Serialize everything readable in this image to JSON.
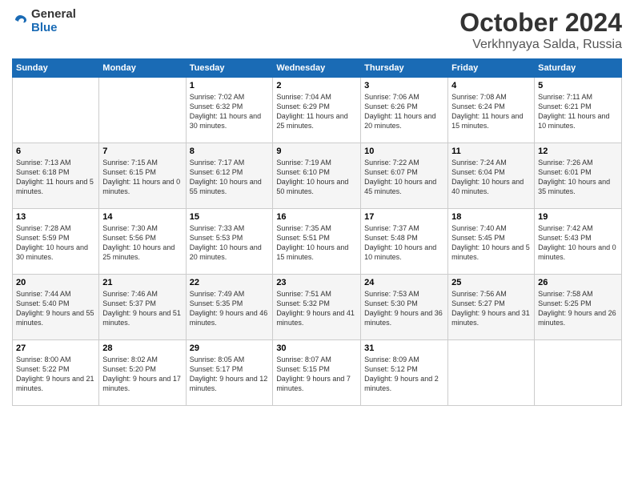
{
  "header": {
    "logo_line1": "General",
    "logo_line2": "Blue",
    "month": "October 2024",
    "location": "Verkhnyaya Salda, Russia"
  },
  "weekdays": [
    "Sunday",
    "Monday",
    "Tuesday",
    "Wednesday",
    "Thursday",
    "Friday",
    "Saturday"
  ],
  "weeks": [
    [
      {
        "day": "",
        "sunrise": "",
        "sunset": "",
        "daylight": ""
      },
      {
        "day": "",
        "sunrise": "",
        "sunset": "",
        "daylight": ""
      },
      {
        "day": "1",
        "sunrise": "Sunrise: 7:02 AM",
        "sunset": "Sunset: 6:32 PM",
        "daylight": "Daylight: 11 hours and 30 minutes."
      },
      {
        "day": "2",
        "sunrise": "Sunrise: 7:04 AM",
        "sunset": "Sunset: 6:29 PM",
        "daylight": "Daylight: 11 hours and 25 minutes."
      },
      {
        "day": "3",
        "sunrise": "Sunrise: 7:06 AM",
        "sunset": "Sunset: 6:26 PM",
        "daylight": "Daylight: 11 hours and 20 minutes."
      },
      {
        "day": "4",
        "sunrise": "Sunrise: 7:08 AM",
        "sunset": "Sunset: 6:24 PM",
        "daylight": "Daylight: 11 hours and 15 minutes."
      },
      {
        "day": "5",
        "sunrise": "Sunrise: 7:11 AM",
        "sunset": "Sunset: 6:21 PM",
        "daylight": "Daylight: 11 hours and 10 minutes."
      }
    ],
    [
      {
        "day": "6",
        "sunrise": "Sunrise: 7:13 AM",
        "sunset": "Sunset: 6:18 PM",
        "daylight": "Daylight: 11 hours and 5 minutes."
      },
      {
        "day": "7",
        "sunrise": "Sunrise: 7:15 AM",
        "sunset": "Sunset: 6:15 PM",
        "daylight": "Daylight: 11 hours and 0 minutes."
      },
      {
        "day": "8",
        "sunrise": "Sunrise: 7:17 AM",
        "sunset": "Sunset: 6:12 PM",
        "daylight": "Daylight: 10 hours and 55 minutes."
      },
      {
        "day": "9",
        "sunrise": "Sunrise: 7:19 AM",
        "sunset": "Sunset: 6:10 PM",
        "daylight": "Daylight: 10 hours and 50 minutes."
      },
      {
        "day": "10",
        "sunrise": "Sunrise: 7:22 AM",
        "sunset": "Sunset: 6:07 PM",
        "daylight": "Daylight: 10 hours and 45 minutes."
      },
      {
        "day": "11",
        "sunrise": "Sunrise: 7:24 AM",
        "sunset": "Sunset: 6:04 PM",
        "daylight": "Daylight: 10 hours and 40 minutes."
      },
      {
        "day": "12",
        "sunrise": "Sunrise: 7:26 AM",
        "sunset": "Sunset: 6:01 PM",
        "daylight": "Daylight: 10 hours and 35 minutes."
      }
    ],
    [
      {
        "day": "13",
        "sunrise": "Sunrise: 7:28 AM",
        "sunset": "Sunset: 5:59 PM",
        "daylight": "Daylight: 10 hours and 30 minutes."
      },
      {
        "day": "14",
        "sunrise": "Sunrise: 7:30 AM",
        "sunset": "Sunset: 5:56 PM",
        "daylight": "Daylight: 10 hours and 25 minutes."
      },
      {
        "day": "15",
        "sunrise": "Sunrise: 7:33 AM",
        "sunset": "Sunset: 5:53 PM",
        "daylight": "Daylight: 10 hours and 20 minutes."
      },
      {
        "day": "16",
        "sunrise": "Sunrise: 7:35 AM",
        "sunset": "Sunset: 5:51 PM",
        "daylight": "Daylight: 10 hours and 15 minutes."
      },
      {
        "day": "17",
        "sunrise": "Sunrise: 7:37 AM",
        "sunset": "Sunset: 5:48 PM",
        "daylight": "Daylight: 10 hours and 10 minutes."
      },
      {
        "day": "18",
        "sunrise": "Sunrise: 7:40 AM",
        "sunset": "Sunset: 5:45 PM",
        "daylight": "Daylight: 10 hours and 5 minutes."
      },
      {
        "day": "19",
        "sunrise": "Sunrise: 7:42 AM",
        "sunset": "Sunset: 5:43 PM",
        "daylight": "Daylight: 10 hours and 0 minutes."
      }
    ],
    [
      {
        "day": "20",
        "sunrise": "Sunrise: 7:44 AM",
        "sunset": "Sunset: 5:40 PM",
        "daylight": "Daylight: 9 hours and 55 minutes."
      },
      {
        "day": "21",
        "sunrise": "Sunrise: 7:46 AM",
        "sunset": "Sunset: 5:37 PM",
        "daylight": "Daylight: 9 hours and 51 minutes."
      },
      {
        "day": "22",
        "sunrise": "Sunrise: 7:49 AM",
        "sunset": "Sunset: 5:35 PM",
        "daylight": "Daylight: 9 hours and 46 minutes."
      },
      {
        "day": "23",
        "sunrise": "Sunrise: 7:51 AM",
        "sunset": "Sunset: 5:32 PM",
        "daylight": "Daylight: 9 hours and 41 minutes."
      },
      {
        "day": "24",
        "sunrise": "Sunrise: 7:53 AM",
        "sunset": "Sunset: 5:30 PM",
        "daylight": "Daylight: 9 hours and 36 minutes."
      },
      {
        "day": "25",
        "sunrise": "Sunrise: 7:56 AM",
        "sunset": "Sunset: 5:27 PM",
        "daylight": "Daylight: 9 hours and 31 minutes."
      },
      {
        "day": "26",
        "sunrise": "Sunrise: 7:58 AM",
        "sunset": "Sunset: 5:25 PM",
        "daylight": "Daylight: 9 hours and 26 minutes."
      }
    ],
    [
      {
        "day": "27",
        "sunrise": "Sunrise: 8:00 AM",
        "sunset": "Sunset: 5:22 PM",
        "daylight": "Daylight: 9 hours and 21 minutes."
      },
      {
        "day": "28",
        "sunrise": "Sunrise: 8:02 AM",
        "sunset": "Sunset: 5:20 PM",
        "daylight": "Daylight: 9 hours and 17 minutes."
      },
      {
        "day": "29",
        "sunrise": "Sunrise: 8:05 AM",
        "sunset": "Sunset: 5:17 PM",
        "daylight": "Daylight: 9 hours and 12 minutes."
      },
      {
        "day": "30",
        "sunrise": "Sunrise: 8:07 AM",
        "sunset": "Sunset: 5:15 PM",
        "daylight": "Daylight: 9 hours and 7 minutes."
      },
      {
        "day": "31",
        "sunrise": "Sunrise: 8:09 AM",
        "sunset": "Sunset: 5:12 PM",
        "daylight": "Daylight: 9 hours and 2 minutes."
      },
      {
        "day": "",
        "sunrise": "",
        "sunset": "",
        "daylight": ""
      },
      {
        "day": "",
        "sunrise": "",
        "sunset": "",
        "daylight": ""
      }
    ]
  ]
}
